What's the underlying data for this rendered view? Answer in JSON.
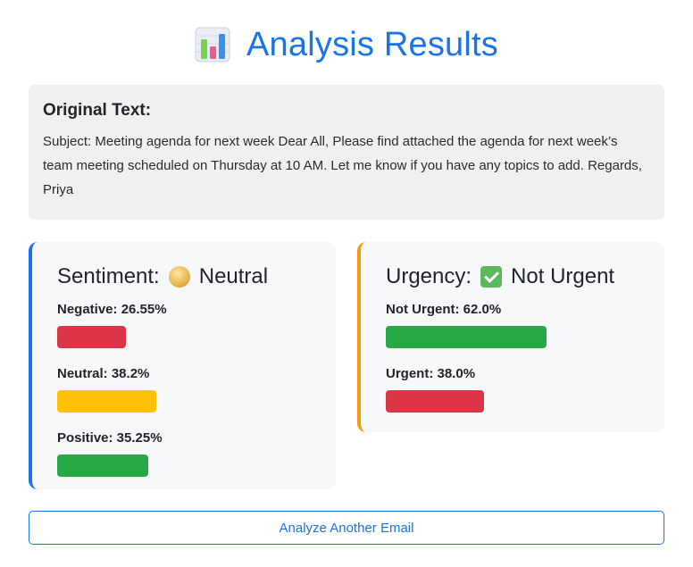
{
  "page": {
    "title": "Analysis Results",
    "title_icon": "bar-chart-icon",
    "accent_color": "#1a73e8"
  },
  "original": {
    "heading": "Original Text:",
    "text": "Subject: Meeting agenda for next week Dear All, Please find attached the agenda for next week’s team meeting scheduled on Thursday at 10 AM. Let me know if you have any topics to add. Regards, Priya"
  },
  "sentiment": {
    "label": "Sentiment:",
    "result_icon": "neutral-face-icon",
    "result": "Neutral",
    "border_color": "#1a73e8",
    "metrics": [
      {
        "label": "Negative: 26.55%",
        "value": 26.55,
        "color": "#dc3545"
      },
      {
        "label": "Neutral: 38.2%",
        "value": 38.2,
        "color": "#ffc107"
      },
      {
        "label": "Positive: 35.25%",
        "value": 35.25,
        "color": "#28a745"
      }
    ]
  },
  "urgency": {
    "label": "Urgency:",
    "result_icon": "check-mark-icon",
    "result": "Not Urgent",
    "border_color": "#f39c12",
    "metrics": [
      {
        "label": "Not Urgent: 62.0%",
        "value": 62.0,
        "color": "#28a745"
      },
      {
        "label": "Urgent: 38.0%",
        "value": 38.0,
        "color": "#dc3545"
      }
    ]
  },
  "actions": {
    "analyze_another": "Analyze Another Email"
  }
}
